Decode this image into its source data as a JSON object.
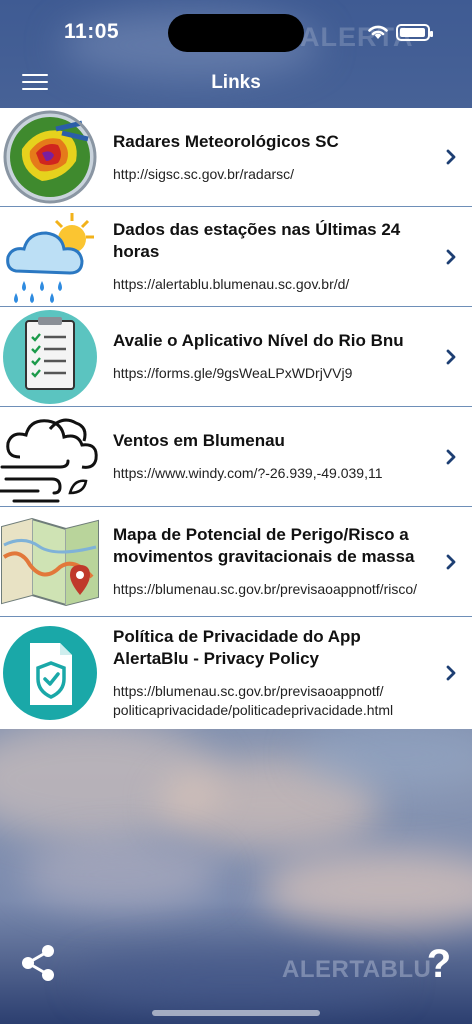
{
  "status_bar": {
    "time": "11:05"
  },
  "header": {
    "title": "Links",
    "watermark": "ALERTA"
  },
  "links": [
    {
      "title": "Radares Meteorológicos SC",
      "url": "http://sigsc.sc.gov.br/radarsc/",
      "icon": "radar-icon"
    },
    {
      "title": "Dados das estações nas Últimas 24 horas",
      "url": "https://alertablu.blumenau.sc.gov.br/d/",
      "icon": "weather-rain-sun-icon"
    },
    {
      "title": "Avalie o Aplicativo Nível do Rio Bnu",
      "url": "https://forms.gle/9gsWeaLPxWDrjVVj9",
      "icon": "checklist-icon"
    },
    {
      "title": "Ventos em Blumenau",
      "url": "https://www.windy.com/?-26.939,-49.039,11",
      "icon": "wind-cloud-icon"
    },
    {
      "title": "Mapa de Potencial de Perigo/Risco a movimentos gravitacionais de massa",
      "url": "https://blumenau.sc.gov.br/previsaoappnotf/risco/",
      "icon": "map-pin-icon"
    },
    {
      "title": "Política de Privacidade do App AlertaBlu - Privacy Policy",
      "url": "https://blumenau.sc.gov.br/previsaoappnotf/ politicaprivacidade/politicadeprivacidade.html",
      "icon": "shield-document-icon"
    }
  ],
  "bottom_bar": {
    "help_label": "?",
    "logo": "ALERTABLU"
  },
  "colors": {
    "divider": "#6e8fb8",
    "chevron": "#1d3f73",
    "teal": "#1aa8a8"
  }
}
